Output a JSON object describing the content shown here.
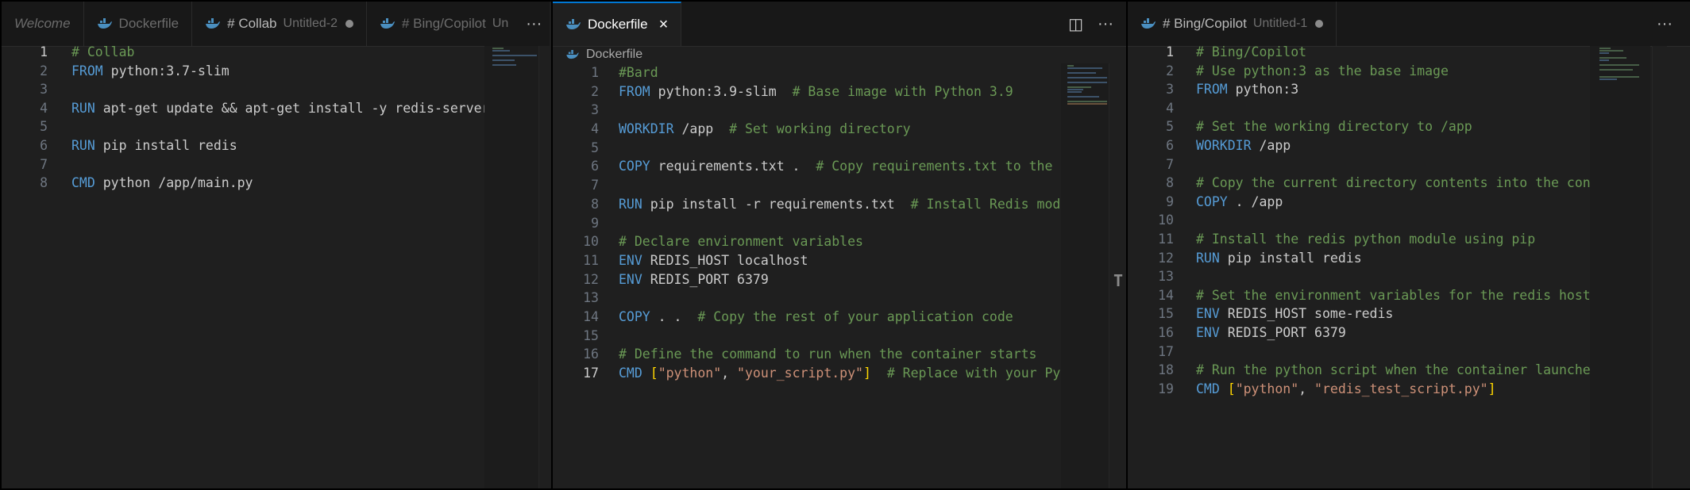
{
  "colors": {
    "accent": "#0078d4",
    "keyword": "#569cd6",
    "comment": "#6a9955",
    "string": "#ce9178",
    "bracket": "#ffd700"
  },
  "group1": {
    "tabs": [
      {
        "label": "Welcome",
        "icon": "none"
      },
      {
        "label": "Dockerfile",
        "icon": "docker-icon"
      },
      {
        "label": "# Collab",
        "sub": "Untitled-2",
        "icon": "docker-icon",
        "dirty": true
      },
      {
        "label": "# Bing/Copilot",
        "sub": "Un",
        "icon": "docker-icon"
      }
    ],
    "more_label": "···",
    "lines": [
      {
        "n": "1",
        "parts": [
          {
            "t": "# Collab",
            "c": "cm"
          }
        ]
      },
      {
        "n": "2",
        "parts": [
          {
            "t": "FROM",
            "c": "kw"
          },
          {
            "t": " python:3.7-slim"
          }
        ]
      },
      {
        "n": "3",
        "parts": []
      },
      {
        "n": "4",
        "parts": [
          {
            "t": "RUN",
            "c": "kw"
          },
          {
            "t": " apt-get update && apt-get install -y redis-server"
          }
        ]
      },
      {
        "n": "5",
        "parts": []
      },
      {
        "n": "6",
        "parts": [
          {
            "t": "RUN",
            "c": "kw"
          },
          {
            "t": " pip install redis"
          }
        ]
      },
      {
        "n": "7",
        "parts": []
      },
      {
        "n": "8",
        "parts": [
          {
            "t": "CMD",
            "c": "kw"
          },
          {
            "t": " python /app/main.py"
          }
        ]
      }
    ]
  },
  "group2": {
    "tabs": [
      {
        "label": "Dockerfile",
        "icon": "docker-icon",
        "close": "×"
      }
    ],
    "split_label": "◫",
    "more_label": "···",
    "breadcrumb": "Dockerfile",
    "cursor_glyph": "T",
    "lines": [
      {
        "n": "1",
        "parts": [
          {
            "t": "#Bard",
            "c": "cm"
          }
        ]
      },
      {
        "n": "2",
        "parts": [
          {
            "t": "FROM",
            "c": "kw"
          },
          {
            "t": " python:3.9-slim  "
          },
          {
            "t": "# Base image with Python 3.9",
            "c": "cm"
          }
        ]
      },
      {
        "n": "3",
        "parts": []
      },
      {
        "n": "4",
        "parts": [
          {
            "t": "WORKDIR",
            "c": "kw"
          },
          {
            "t": " /app  "
          },
          {
            "t": "# Set working directory",
            "c": "cm"
          }
        ]
      },
      {
        "n": "5",
        "parts": []
      },
      {
        "n": "6",
        "parts": [
          {
            "t": "COPY",
            "c": "kw"
          },
          {
            "t": " requirements.txt .  "
          },
          {
            "t": "# Copy requirements.txt to the co",
            "c": "cm"
          }
        ]
      },
      {
        "n": "7",
        "parts": []
      },
      {
        "n": "8",
        "parts": [
          {
            "t": "RUN",
            "c": "kw"
          },
          {
            "t": " pip install -r requirements.txt  "
          },
          {
            "t": "# Install Redis modul",
            "c": "cm"
          }
        ]
      },
      {
        "n": "9",
        "parts": []
      },
      {
        "n": "10",
        "parts": [
          {
            "t": "# Declare environment variables",
            "c": "cm"
          }
        ]
      },
      {
        "n": "11",
        "parts": [
          {
            "t": "ENV",
            "c": "kw"
          },
          {
            "t": " REDIS_HOST localhost"
          }
        ]
      },
      {
        "n": "12",
        "parts": [
          {
            "t": "ENV",
            "c": "kw"
          },
          {
            "t": " REDIS_PORT 6379"
          }
        ]
      },
      {
        "n": "13",
        "parts": []
      },
      {
        "n": "14",
        "parts": [
          {
            "t": "COPY",
            "c": "kw"
          },
          {
            "t": " . .  "
          },
          {
            "t": "# Copy the rest of your application code",
            "c": "cm"
          }
        ]
      },
      {
        "n": "15",
        "parts": []
      },
      {
        "n": "16",
        "parts": [
          {
            "t": "# Define the command to run when the container starts",
            "c": "cm"
          }
        ]
      },
      {
        "n": "17",
        "parts": [
          {
            "t": "CMD",
            "c": "kw"
          },
          {
            "t": " "
          },
          {
            "t": "[",
            "c": "br"
          },
          {
            "t": "\"python\"",
            "c": "str"
          },
          {
            "t": ", "
          },
          {
            "t": "\"your_script.py\"",
            "c": "str"
          },
          {
            "t": "]",
            "c": "br"
          },
          {
            "t": "  "
          },
          {
            "t": "# Replace with your Pyth",
            "c": "cm"
          }
        ]
      }
    ]
  },
  "group3": {
    "tabs": [
      {
        "label": "# Bing/Copilot",
        "sub": "Untitled-1",
        "icon": "docker-icon",
        "dirty": true
      }
    ],
    "more_label": "···",
    "lines": [
      {
        "n": "1",
        "parts": [
          {
            "t": "# Bing/Copilot",
            "c": "cm"
          }
        ]
      },
      {
        "n": "2",
        "parts": [
          {
            "t": "# Use python:3 as the base image",
            "c": "cm"
          }
        ]
      },
      {
        "n": "3",
        "parts": [
          {
            "t": "FROM",
            "c": "kw"
          },
          {
            "t": " python:3"
          }
        ]
      },
      {
        "n": "4",
        "parts": []
      },
      {
        "n": "5",
        "parts": [
          {
            "t": "# Set the working directory to /app",
            "c": "cm"
          }
        ]
      },
      {
        "n": "6",
        "parts": [
          {
            "t": "WORKDIR",
            "c": "kw"
          },
          {
            "t": " /app"
          }
        ]
      },
      {
        "n": "7",
        "parts": []
      },
      {
        "n": "8",
        "parts": [
          {
            "t": "# Copy the current directory contents into the conta",
            "c": "cm"
          }
        ]
      },
      {
        "n": "9",
        "parts": [
          {
            "t": "COPY",
            "c": "kw"
          },
          {
            "t": " . /app"
          }
        ]
      },
      {
        "n": "10",
        "parts": []
      },
      {
        "n": "11",
        "parts": [
          {
            "t": "# Install the redis python module using pip",
            "c": "cm"
          }
        ]
      },
      {
        "n": "12",
        "parts": [
          {
            "t": "RUN",
            "c": "kw"
          },
          {
            "t": " pip install redis"
          }
        ]
      },
      {
        "n": "13",
        "parts": []
      },
      {
        "n": "14",
        "parts": [
          {
            "t": "# Set the environment variables for the redis host a",
            "c": "cm"
          }
        ]
      },
      {
        "n": "15",
        "parts": [
          {
            "t": "ENV",
            "c": "kw"
          },
          {
            "t": " REDIS_HOST some-redis"
          }
        ]
      },
      {
        "n": "16",
        "parts": [
          {
            "t": "ENV",
            "c": "kw"
          },
          {
            "t": " REDIS_PORT 6379"
          }
        ]
      },
      {
        "n": "17",
        "parts": []
      },
      {
        "n": "18",
        "parts": [
          {
            "t": "# Run the python script when the container launches",
            "c": "cm"
          }
        ]
      },
      {
        "n": "19",
        "parts": [
          {
            "t": "CMD",
            "c": "kw"
          },
          {
            "t": " "
          },
          {
            "t": "[",
            "c": "br"
          },
          {
            "t": "\"python\"",
            "c": "str"
          },
          {
            "t": ", "
          },
          {
            "t": "\"redis_test_script.py\"",
            "c": "str"
          },
          {
            "t": "]",
            "c": "br"
          }
        ]
      }
    ]
  }
}
